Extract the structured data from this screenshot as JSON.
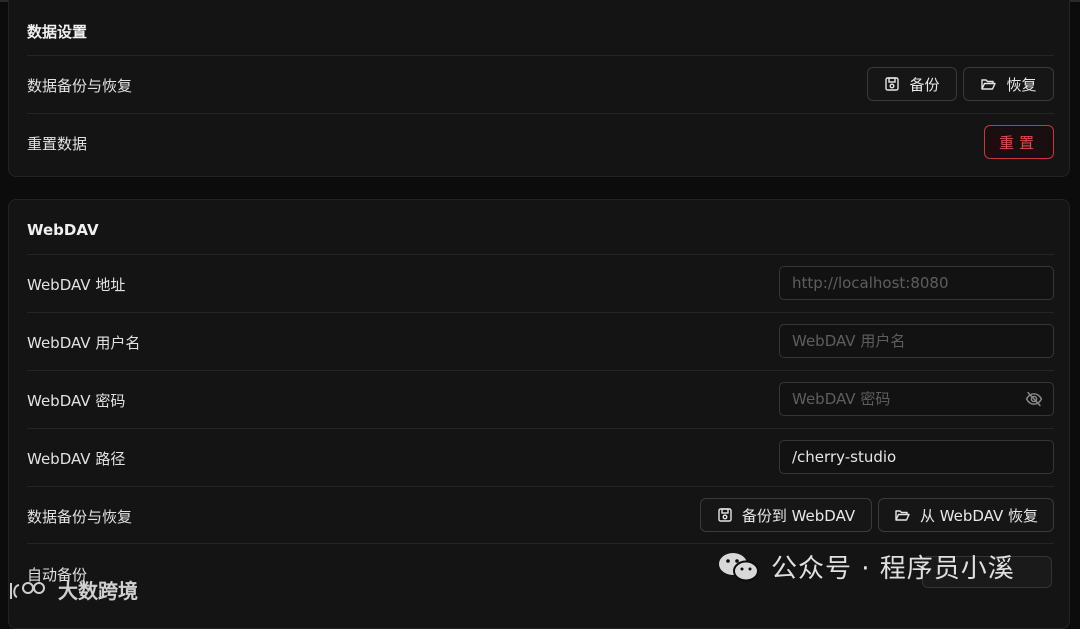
{
  "data_settings": {
    "title": "数据设置",
    "backup_row": {
      "label": "数据备份与恢复",
      "backup_button": "备份",
      "restore_button": "恢复"
    },
    "reset_row": {
      "label": "重置数据",
      "reset_button": "重置"
    }
  },
  "webdav": {
    "title": "WebDAV",
    "host": {
      "label": "WebDAV 地址",
      "value": "",
      "placeholder": "http://localhost:8080"
    },
    "user": {
      "label": "WebDAV 用户名",
      "value": "",
      "placeholder": "WebDAV 用户名"
    },
    "password": {
      "label": "WebDAV 密码",
      "value": "",
      "placeholder": "WebDAV 密码"
    },
    "path": {
      "label": "WebDAV 路径",
      "value": "/cherry-studio",
      "placeholder": ""
    },
    "backup_row": {
      "label": "数据备份与恢复",
      "backup_button": "备份到 WebDAV",
      "restore_button": "从 WebDAV 恢复"
    },
    "auto_backup": {
      "label": "自动备份"
    }
  },
  "watermarks": {
    "left": "大数跨境",
    "right": "公众号 · 程序员小溪"
  },
  "colors": {
    "background": "#0c0c0c",
    "card": "#141414",
    "danger": "#e04a4f"
  },
  "icons": {
    "save": "save-icon",
    "folder": "folder-open-icon",
    "eye_off": "eye-off-icon",
    "wechat": "wechat-icon"
  }
}
